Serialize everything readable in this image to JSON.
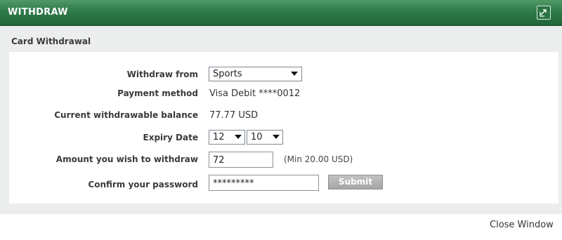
{
  "header": {
    "title": "WITHDRAW",
    "icon": "popout-icon"
  },
  "section": {
    "title": "Card Withdrawal"
  },
  "form": {
    "withdraw_from": {
      "label": "Withdraw from",
      "value": "Sports"
    },
    "payment_method": {
      "label": "Payment method",
      "value": "Visa Debit ****0012"
    },
    "balance": {
      "label": "Current withdrawable balance",
      "value": "77.77 USD"
    },
    "expiry": {
      "label": "Expiry Date",
      "month": "12",
      "year": "10"
    },
    "amount": {
      "label": "Amount you wish to withdraw",
      "value": "72",
      "note": "(Min 20.00 USD)"
    },
    "password": {
      "label": "Confirm your password",
      "value": "*********"
    },
    "submit_label": "Submit"
  },
  "footer": {
    "close_label": "Close Window"
  },
  "colors": {
    "header_green": "#2f7a49",
    "panel_bg": "#eceeee"
  }
}
